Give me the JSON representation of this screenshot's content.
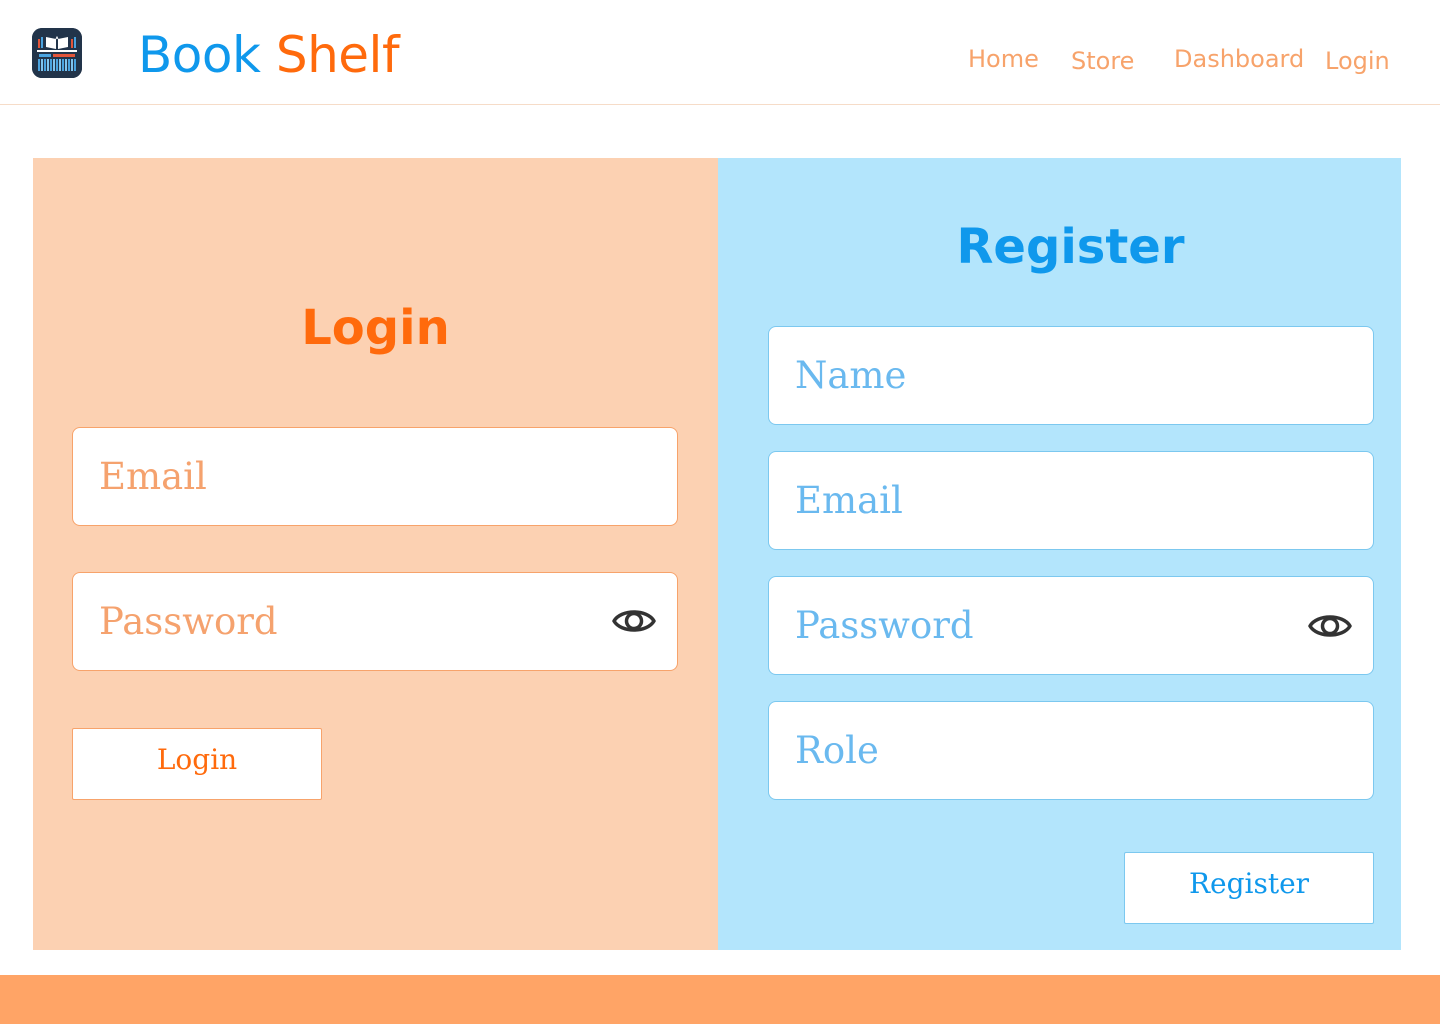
{
  "brand": {
    "part1": "Book",
    "part2": "Shelf",
    "color1": "#0f98ec",
    "color2": "#ff6a0c"
  },
  "nav": {
    "home": "Home",
    "store": "Store",
    "dashboard": "Dashboard",
    "login": "Login",
    "color": "#f7a36b"
  },
  "login": {
    "title": "Login",
    "email_placeholder": "Email",
    "password_placeholder": "Password",
    "button_label": "Login",
    "panel_color": "#fcd1b2",
    "accent": "#ff6a0c"
  },
  "register": {
    "title": "Register",
    "name_placeholder": "Name",
    "email_placeholder": "Email",
    "password_placeholder": "Password",
    "role_placeholder": "Role",
    "button_label": "Register",
    "panel_color": "#b3e5fc",
    "accent": "#0f98ec"
  },
  "icons": {
    "logo": "bookshelf-logo-icon",
    "toggle_password": "eye-icon"
  },
  "footer": {
    "color": "#ffa466"
  }
}
